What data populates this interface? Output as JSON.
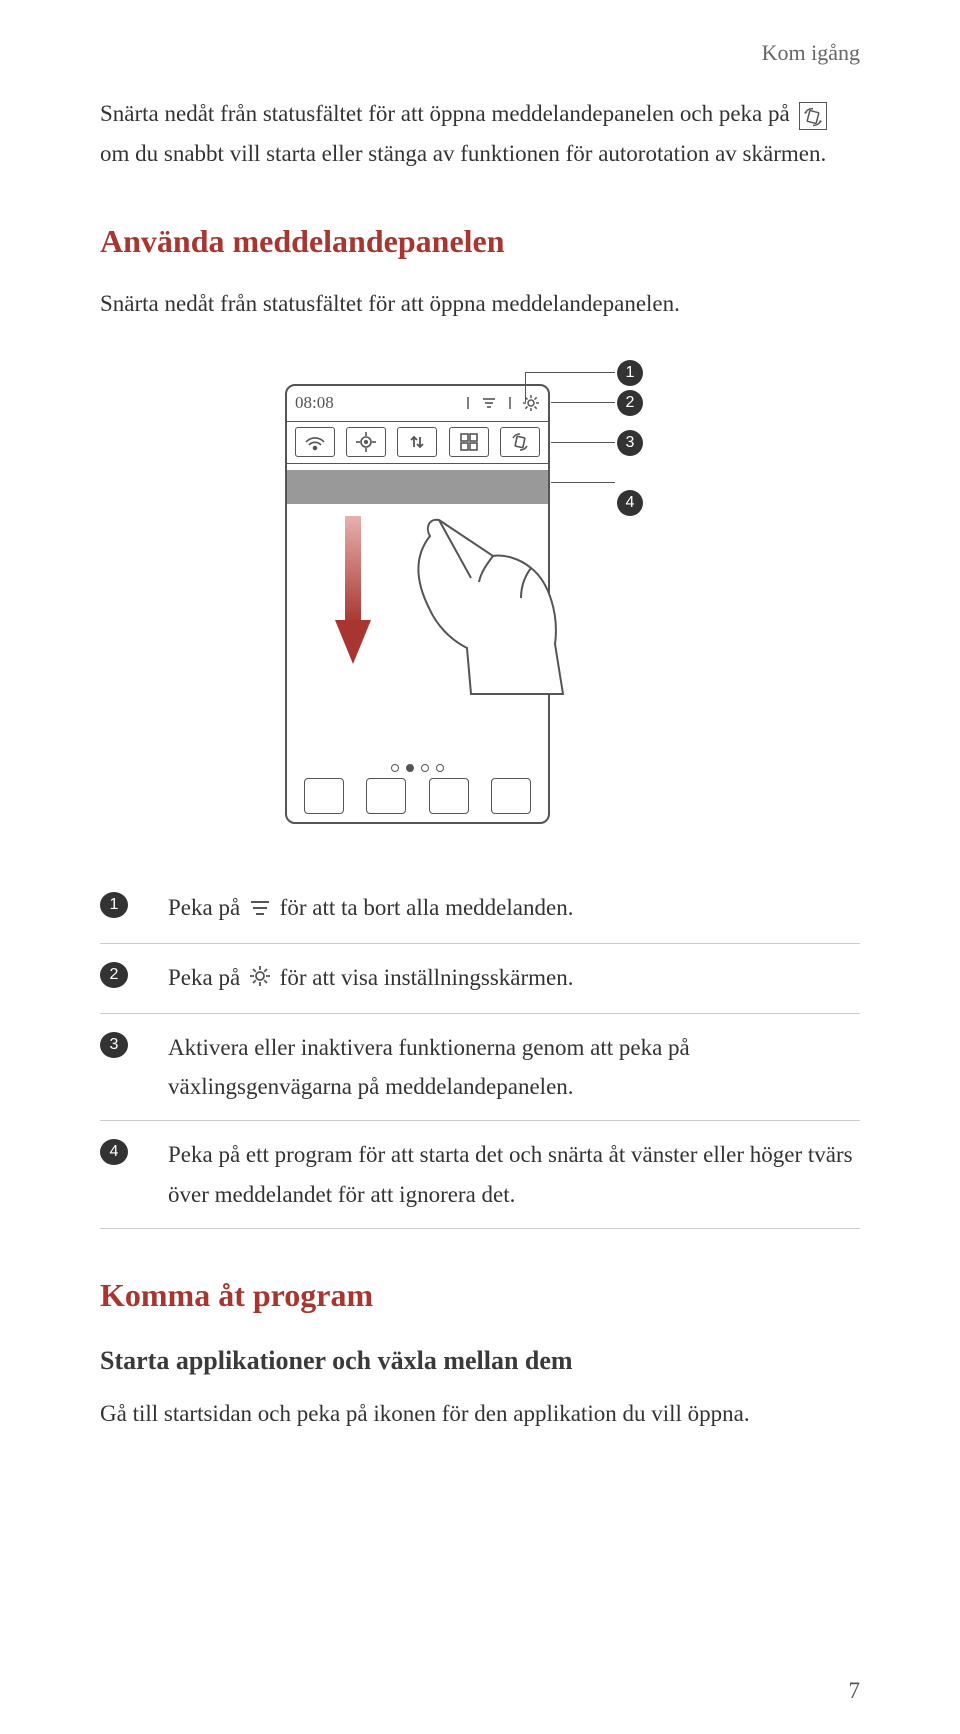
{
  "header": {
    "breadcrumb": "Kom igång"
  },
  "intro": {
    "p1a": "Snärta nedåt från statusfältet för att öppna meddelandepanelen och peka på",
    "p1b": "om du snabbt vill starta eller stänga av funktionen för autorotation av skärmen."
  },
  "section2": {
    "title": "Använda meddelandepanelen",
    "p1": "Snärta nedåt från statusfältet för att öppna meddelandepanelen."
  },
  "diagram": {
    "time": "08:08",
    "callouts": [
      "1",
      "2",
      "3",
      "4"
    ]
  },
  "legend": [
    {
      "num": "1",
      "prefix": "Peka på ",
      "suffix": "för att ta bort alla meddelanden.",
      "icon": "clear"
    },
    {
      "num": "2",
      "prefix": "Peka på ",
      "suffix": "för att visa inställningsskärmen.",
      "icon": "gear"
    },
    {
      "num": "3",
      "text": "Aktivera eller inaktivera funktionerna genom att peka på växlingsgenvägarna på meddelandepanelen."
    },
    {
      "num": "4",
      "text": "Peka på ett program för att starta det och snärta åt vänster eller höger tvärs över meddelandet för att ignorera det."
    }
  ],
  "section3": {
    "title": "Komma åt program",
    "sub1": "Starta applikationer och växla mellan dem",
    "p1": "Gå till startsidan och peka på ikonen för den applikation du vill öppna."
  },
  "page_number": "7"
}
